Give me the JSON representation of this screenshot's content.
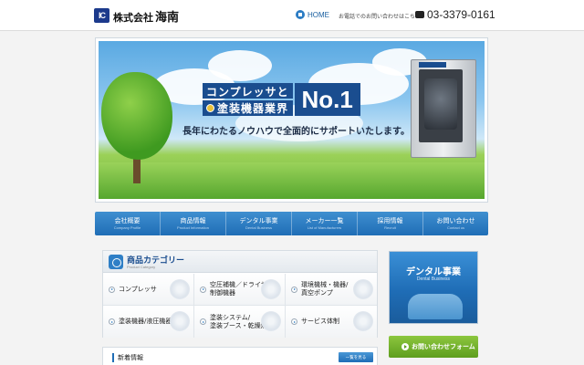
{
  "header": {
    "logo_mark": "IC",
    "company_prefix": "株式会社",
    "company_name": "海南",
    "home_label": "HOME",
    "inquiry_note": "お電話でのお問い合わせはこちら",
    "phone": "03-3379-0161"
  },
  "hero": {
    "catch_line1": "コンプレッサと",
    "catch_line2": "塗装機器業界",
    "catch_no1": "No.1",
    "catch_sub": "長年にわたるノウハウで全面的にサポートいたします。"
  },
  "nav": [
    {
      "jp": "会社概要",
      "en": "Company Profile"
    },
    {
      "jp": "商品情報",
      "en": "Product Information"
    },
    {
      "jp": "デンタル事業",
      "en": "Dental Business"
    },
    {
      "jp": "メーカー一覧",
      "en": "List of Manufacturers"
    },
    {
      "jp": "採用情報",
      "en": "Recruit"
    },
    {
      "jp": "お問い合わせ",
      "en": "Contact us"
    }
  ],
  "categories": {
    "title": "商品カテゴリー",
    "subtitle": "Product Category",
    "items": [
      {
        "label": "コンプレッサ"
      },
      {
        "label": "空圧補機／ドライヤ/\n制御機器"
      },
      {
        "label": "環境機械・機器/\n真空ポンプ"
      },
      {
        "label": "塗装機器/液圧機器"
      },
      {
        "label": "塗装システム/\n塗装ブース・乾燥炉"
      },
      {
        "label": "サービス体制"
      }
    ]
  },
  "news": {
    "title": "新着情報",
    "list_button": "一覧を見る"
  },
  "sidebar": {
    "dental_title": "デンタル事業",
    "dental_sub": "Dental Business",
    "contact_label": "お問い合わせフォーム"
  },
  "colors": {
    "brand_blue": "#1f6db6",
    "nav_blue": "#3f8fd0",
    "contact_green": "#6fae28"
  }
}
